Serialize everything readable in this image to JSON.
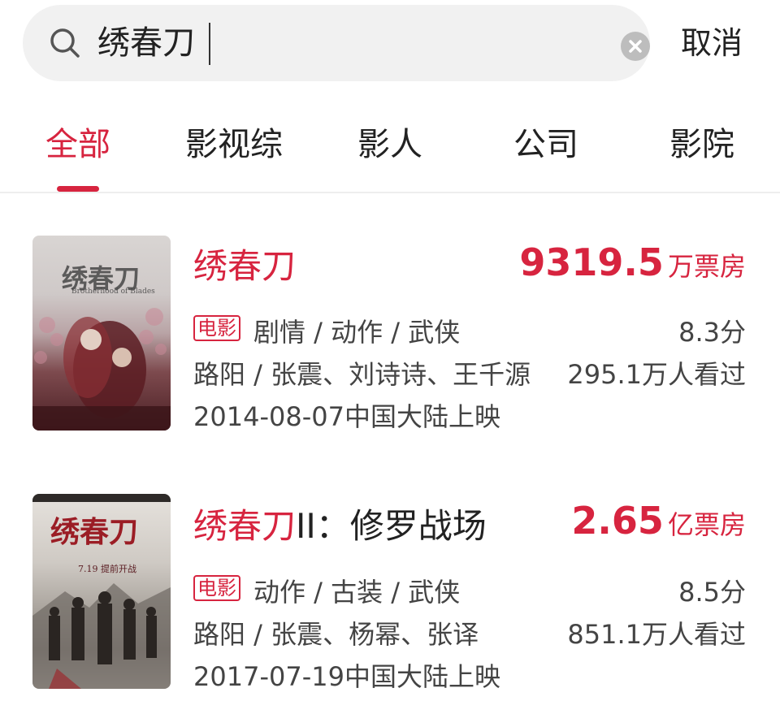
{
  "search": {
    "query": "绣春刀",
    "cancel_label": "取消"
  },
  "tabs": [
    {
      "label": "全部",
      "active": true
    },
    {
      "label": "影视综",
      "active": false
    },
    {
      "label": "影人",
      "active": false
    },
    {
      "label": "公司",
      "active": false
    },
    {
      "label": "影院",
      "active": false
    }
  ],
  "results": [
    {
      "title": "绣春刀",
      "title_suffix": "",
      "box_office_value": "9319.5",
      "box_office_unit": "万票房",
      "type_tag": "电影",
      "genres": "剧情 / 动作 / 武侠",
      "rating": "8.3分",
      "people": "路阳 / 张震、刘诗诗、王千源",
      "viewers": "295.1万人看过",
      "release": "2014-08-07中国大陆上映",
      "poster_text": "绣春刀",
      "poster_subtext": "Brotherhood of Blades"
    },
    {
      "title": "绣春刀",
      "title_suffix": "II：修罗战场",
      "box_office_value": "2.65",
      "box_office_unit": "亿票房",
      "type_tag": "电影",
      "genres": "动作 / 古装 / 武侠",
      "rating": "8.5分",
      "people": "路阳 / 张震、杨幂、张译",
      "viewers": "851.1万人看过",
      "release": "2017-07-19中国大陆上映",
      "poster_text": "绣春刀",
      "poster_subtext": "7.19 提前开战"
    }
  ],
  "colors": {
    "accent": "#d7243f",
    "text": "#222222",
    "secondary_text": "#444444"
  }
}
